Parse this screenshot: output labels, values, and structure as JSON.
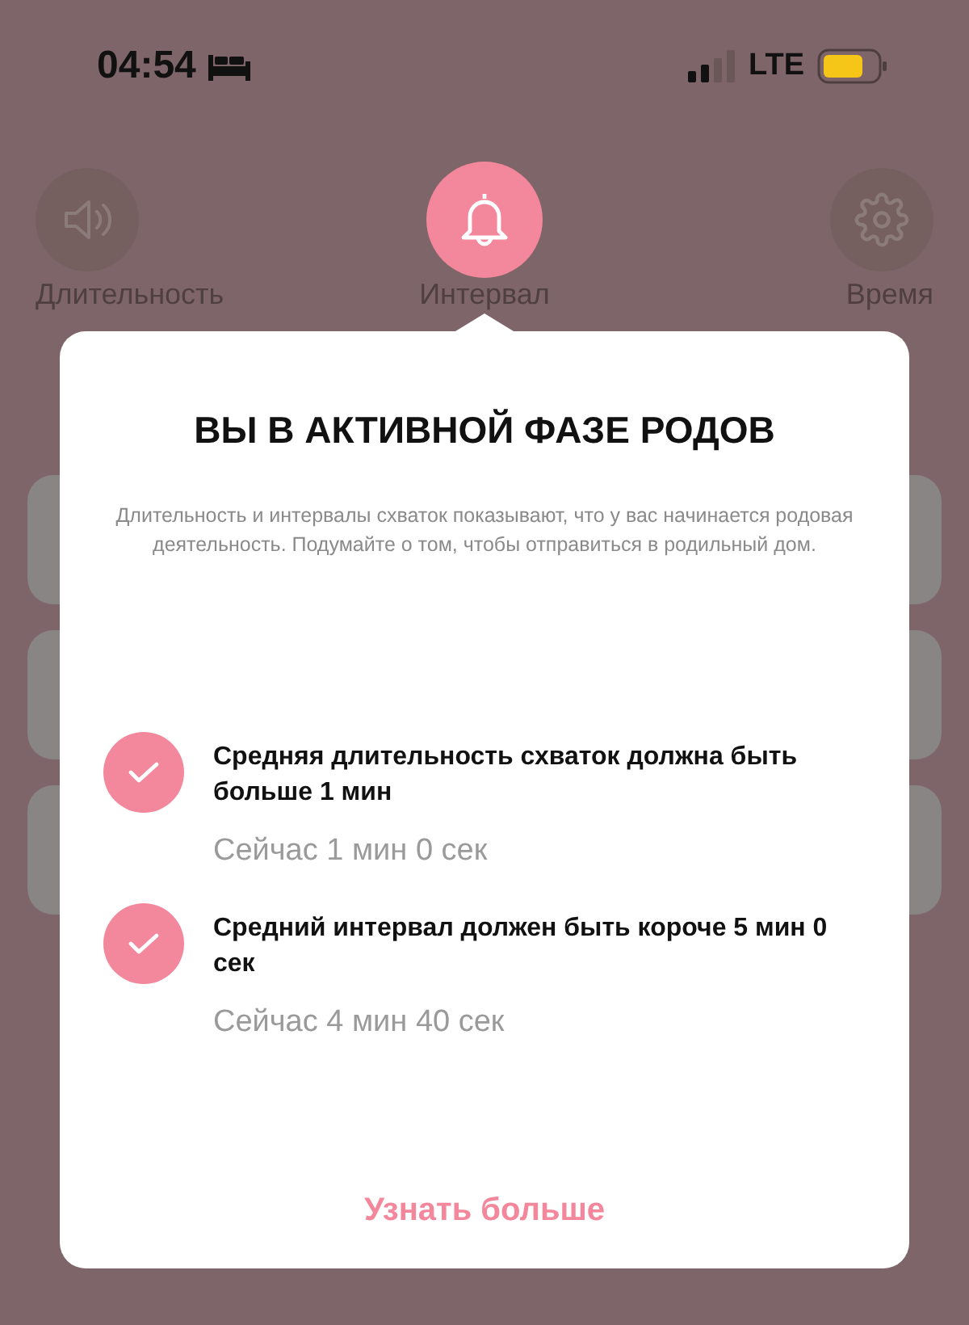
{
  "status_bar": {
    "time": "04:54",
    "network": "LTE"
  },
  "tabs": [
    {
      "kind": "sound",
      "label": "Длительность",
      "selected": false
    },
    {
      "kind": "bell",
      "label": "Интервал",
      "selected": true
    },
    {
      "kind": "gear",
      "label": "Время",
      "selected": false
    }
  ],
  "dialog": {
    "title": "ВЫ В АКТИВНОЙ ФАЗЕ РОДОВ",
    "description": "Длительность и интервалы схваток показывают, что у вас начинается родовая деятельность. Подумайте о том, чтобы отправиться в родильный дом.",
    "criteria": [
      {
        "text": "Средняя длительность схваток должна быть больше 1 мин",
        "current": "Сейчас 1 мин 0 сек",
        "checked": true
      },
      {
        "text": "Средний интервал должен быть короче 5 мин 0 сек",
        "current": "Сейчас 4 мин 40 сек",
        "checked": true
      }
    ],
    "link": "Узнать больше"
  }
}
